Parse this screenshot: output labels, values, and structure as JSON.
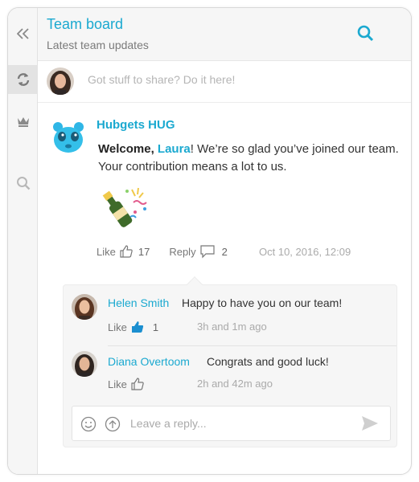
{
  "header": {
    "title": "Team board",
    "subtitle": "Latest team updates"
  },
  "sidebar": {
    "items": [
      {
        "icon": "collapse-icon"
      },
      {
        "icon": "refresh-icon"
      },
      {
        "icon": "crown-icon"
      },
      {
        "icon": "search-icon"
      }
    ]
  },
  "composer": {
    "placeholder": "Got stuff to share? Do it here!"
  },
  "post": {
    "author": "Hubgets HUG",
    "welcome": "Welcome,",
    "mention": "Laura",
    "message_after_mention": "! We’re so glad you’ve joined our team. Your contribution means a lot to us.",
    "like_label": "Like",
    "like_count": "17",
    "reply_label": "Reply",
    "reply_count": "2",
    "timestamp": "Oct 10, 2016, 12:09"
  },
  "replies": [
    {
      "author": "Helen Smith",
      "text": "Happy to have you on our team!",
      "like_label": "Like",
      "like_count": "1",
      "time": "3h and 1m ago"
    },
    {
      "author": "Diana Overtoom",
      "text": "Congrats and good luck!",
      "like_label": "Like",
      "like_count": "",
      "time": "2h and 42m ago"
    }
  ],
  "reply_box": {
    "placeholder": "Leave a reply..."
  },
  "colors": {
    "accent": "#1ba9d0",
    "sidebar_bg": "#f6f6f6",
    "like_active": "#1b8fd0"
  }
}
